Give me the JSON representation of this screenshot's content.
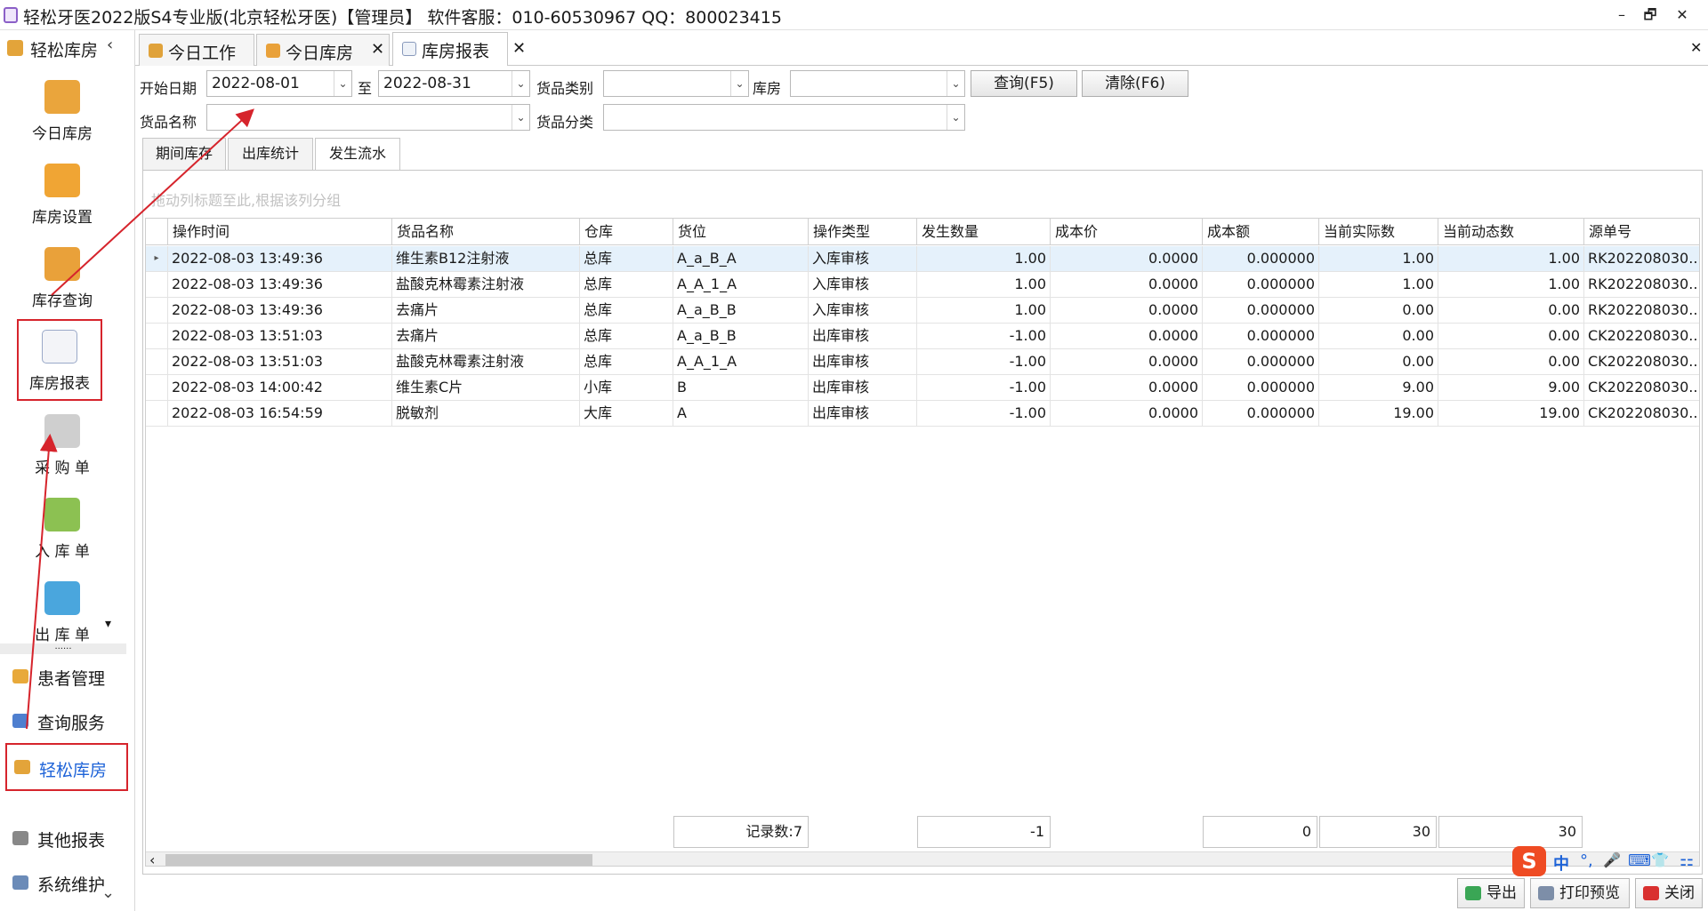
{
  "window": {
    "title": "轻松牙医2022版S4专业版(北京轻松牙医)【管理员】   软件客服：010-60530967 QQ：800023415",
    "minimize": "–",
    "restore": "🗗",
    "close": "✕"
  },
  "sidebar": {
    "title": "轻松库房",
    "collapse": "‹",
    "tools": [
      {
        "label": "今日库房",
        "icon": "cart-box-icon"
      },
      {
        "label": "库房设置",
        "icon": "gear-box-icon"
      },
      {
        "label": "库存查询",
        "icon": "boxes-icon"
      },
      {
        "label": "库房报表",
        "icon": "report-chart-icon"
      },
      {
        "label": "采 购 单",
        "icon": "shopping-cart-icon"
      },
      {
        "label": "入 库 单",
        "icon": "inbox-down-icon"
      },
      {
        "label": "出 库 单",
        "icon": "inbox-up-icon"
      }
    ],
    "more": "▾",
    "splitter": "......",
    "nav": [
      {
        "label": "患者管理",
        "icon": "patients-icon"
      },
      {
        "label": "查询服务",
        "icon": "query-icon"
      },
      {
        "label": "轻松库房",
        "icon": "warehouse-icon"
      },
      {
        "label": "其他报表",
        "icon": "other-report-icon"
      },
      {
        "label": "系统维护",
        "icon": "maintenance-icon"
      }
    ],
    "scroll_down": "⌄"
  },
  "tabs": [
    {
      "label": "今日工作",
      "closable": false
    },
    {
      "label": "今日库房",
      "closable": true
    },
    {
      "label": "库房报表",
      "closable": true
    }
  ],
  "tab_close_glyph": "✕",
  "tabstrip_close": "✕",
  "filters": {
    "start_date_label": "开始日期",
    "start_date": "2022-08-01",
    "to_label": "至",
    "end_date": "2022-08-31",
    "goods_type_label": "货品类别",
    "goods_type": "",
    "warehouse_label": "库房",
    "warehouse": "",
    "query_button": "查询(F5)",
    "clear_button": "清除(F6)",
    "goods_name_label": "货品名称",
    "goods_name": "",
    "goods_class_label": "货品分类",
    "goods_class": "",
    "dropdown_glyph": "⌄"
  },
  "subtabs": [
    "期间库存",
    "出库统计",
    "发生流水"
  ],
  "active_subtab": 2,
  "grid": {
    "group_hint": "拖动列标题至此,根据该列分组",
    "columns": [
      "操作时间",
      "货品名称",
      "仓库",
      "货位",
      "操作类型",
      "发生数量",
      "成本价",
      "成本额",
      "当前实际数",
      "当前动态数",
      "源单号"
    ],
    "row_indicator": "▸",
    "rows": [
      [
        "2022-08-03 13:49:36",
        "维生素B12注射液",
        "总库",
        "A_a_B_A",
        "入库审核",
        "1.00",
        "0.0000",
        "0.000000",
        "1.00",
        "1.00",
        "RK202208030..."
      ],
      [
        "2022-08-03 13:49:36",
        "盐酸克林霉素注射液",
        "总库",
        "A_A_1_A",
        "入库审核",
        "1.00",
        "0.0000",
        "0.000000",
        "1.00",
        "1.00",
        "RK202208030..."
      ],
      [
        "2022-08-03 13:49:36",
        "去痛片",
        "总库",
        "A_a_B_B",
        "入库审核",
        "1.00",
        "0.0000",
        "0.000000",
        "0.00",
        "0.00",
        "RK202208030..."
      ],
      [
        "2022-08-03 13:51:03",
        "去痛片",
        "总库",
        "A_a_B_B",
        "出库审核",
        "-1.00",
        "0.0000",
        "0.000000",
        "0.00",
        "0.00",
        "CK202208030..."
      ],
      [
        "2022-08-03 13:51:03",
        "盐酸克林霉素注射液",
        "总库",
        "A_A_1_A",
        "出库审核",
        "-1.00",
        "0.0000",
        "0.000000",
        "0.00",
        "0.00",
        "CK202208030..."
      ],
      [
        "2022-08-03 14:00:42",
        "维生素C片",
        "小库",
        "B",
        "出库审核",
        "-1.00",
        "0.0000",
        "0.000000",
        "9.00",
        "9.00",
        "CK202208030..."
      ],
      [
        "2022-08-03 16:54:59",
        "脱敏剂",
        "大库",
        "A",
        "出库审核",
        "-1.00",
        "0.0000",
        "0.000000",
        "19.00",
        "19.00",
        "CK202208030..."
      ]
    ],
    "footer": {
      "record_count": "记录数:7",
      "qty_sum": "-1",
      "cost_sum": "0",
      "actual_sum": "30",
      "dynamic_sum": "30"
    },
    "scroll_left": "‹"
  },
  "bottom_buttons": {
    "export": "导出",
    "print_preview": "打印预览",
    "close": "关闭"
  },
  "ime": {
    "logo": "S",
    "items": [
      "中",
      "°,",
      "🎤",
      "⌨",
      "👕",
      "⚏"
    ]
  },
  "colors": {
    "highlight_red": "#d6242c",
    "selected_row": "#e5f1fb",
    "accent_blue": "#1e63d8"
  }
}
